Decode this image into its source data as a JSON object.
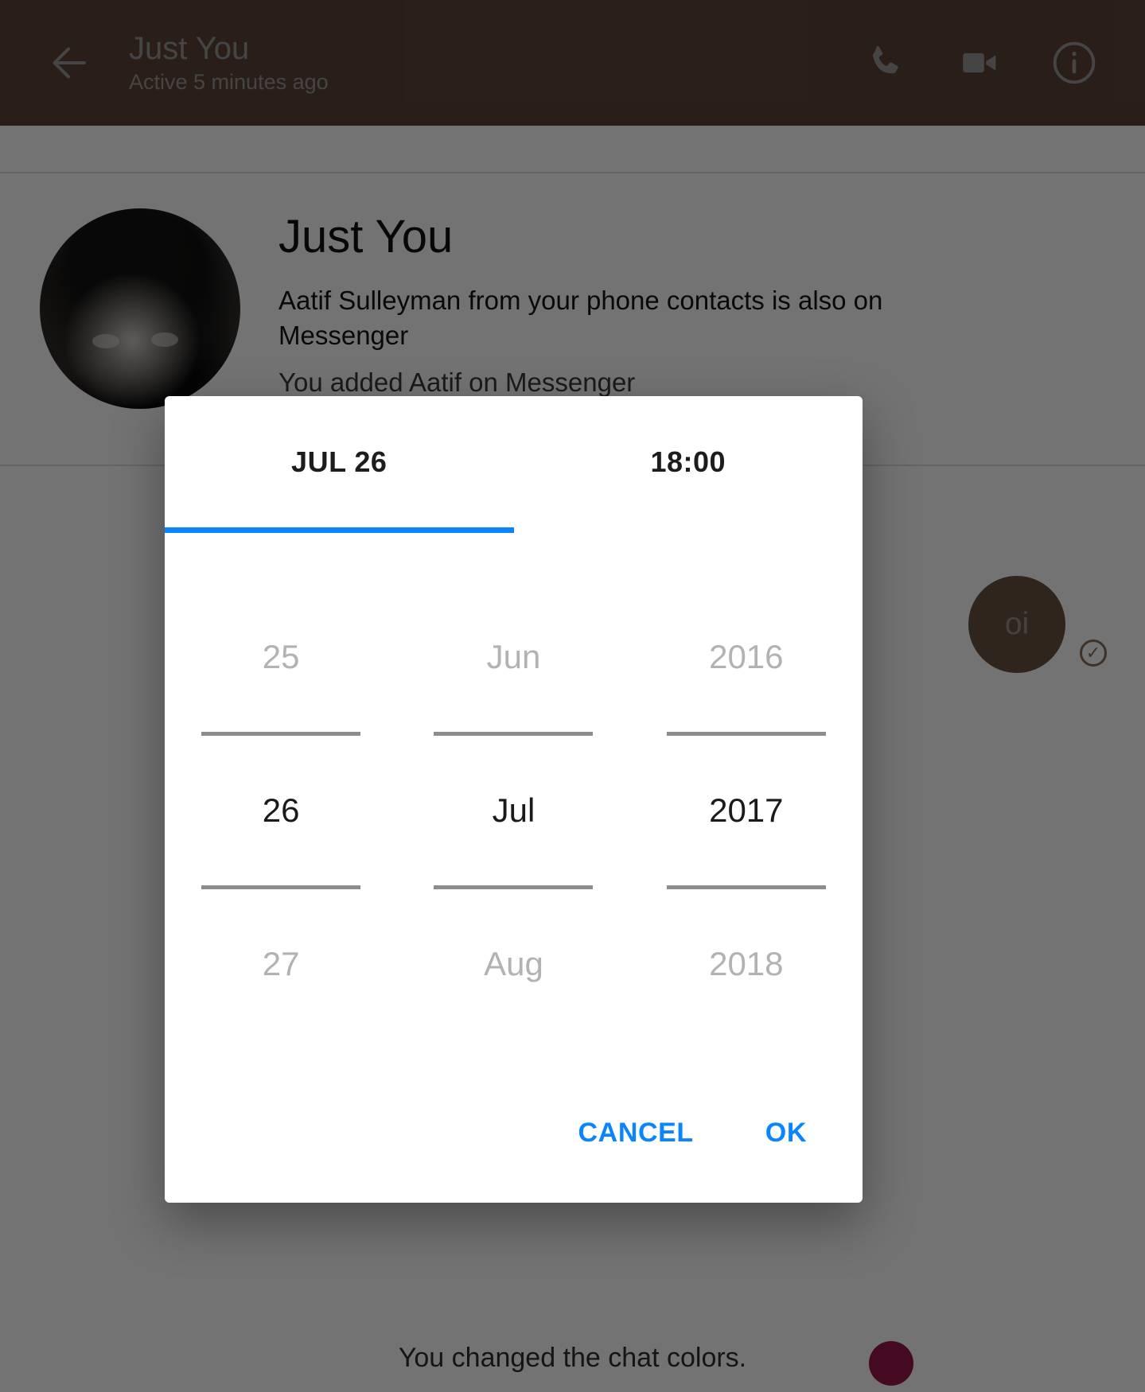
{
  "appbar": {
    "back_icon": "arrow-left-icon",
    "title": "Just You",
    "subtitle": "Active 5 minutes ago",
    "actions": [
      {
        "icon": "phone-icon",
        "label": "Call"
      },
      {
        "icon": "video-camera-icon",
        "label": "Video call"
      },
      {
        "icon": "info-circle-icon",
        "label": "Details"
      }
    ],
    "background_color": "#5e4637"
  },
  "thread": {
    "profile": {
      "name": "Just You",
      "subtitle": "Aatif Sulleyman from your phone contacts is also on Messenger",
      "secondary": "You added Aatif on Messenger",
      "avatar_alt": "Profile photo"
    },
    "message": {
      "text": "oi",
      "bubble_color": "#6b5241",
      "status_icon": "check-circle-icon"
    },
    "system_note": "You changed the chat colors.",
    "color_swatch": "#96174c"
  },
  "dialog": {
    "tabs": [
      {
        "label": "JUL 26",
        "selected": true
      },
      {
        "label": "18:00",
        "selected": false
      }
    ],
    "indicator_color": "#0a84ff",
    "picker": {
      "columns": [
        {
          "name": "day",
          "previous": "25",
          "selected": "26",
          "next": "27"
        },
        {
          "name": "month",
          "previous": "Jun",
          "selected": "Jul",
          "next": "Aug"
        },
        {
          "name": "year",
          "previous": "2016",
          "selected": "2017",
          "next": "2018"
        }
      ]
    },
    "buttons": {
      "cancel": "CANCEL",
      "ok": "OK",
      "color": "#0a84ff"
    }
  }
}
